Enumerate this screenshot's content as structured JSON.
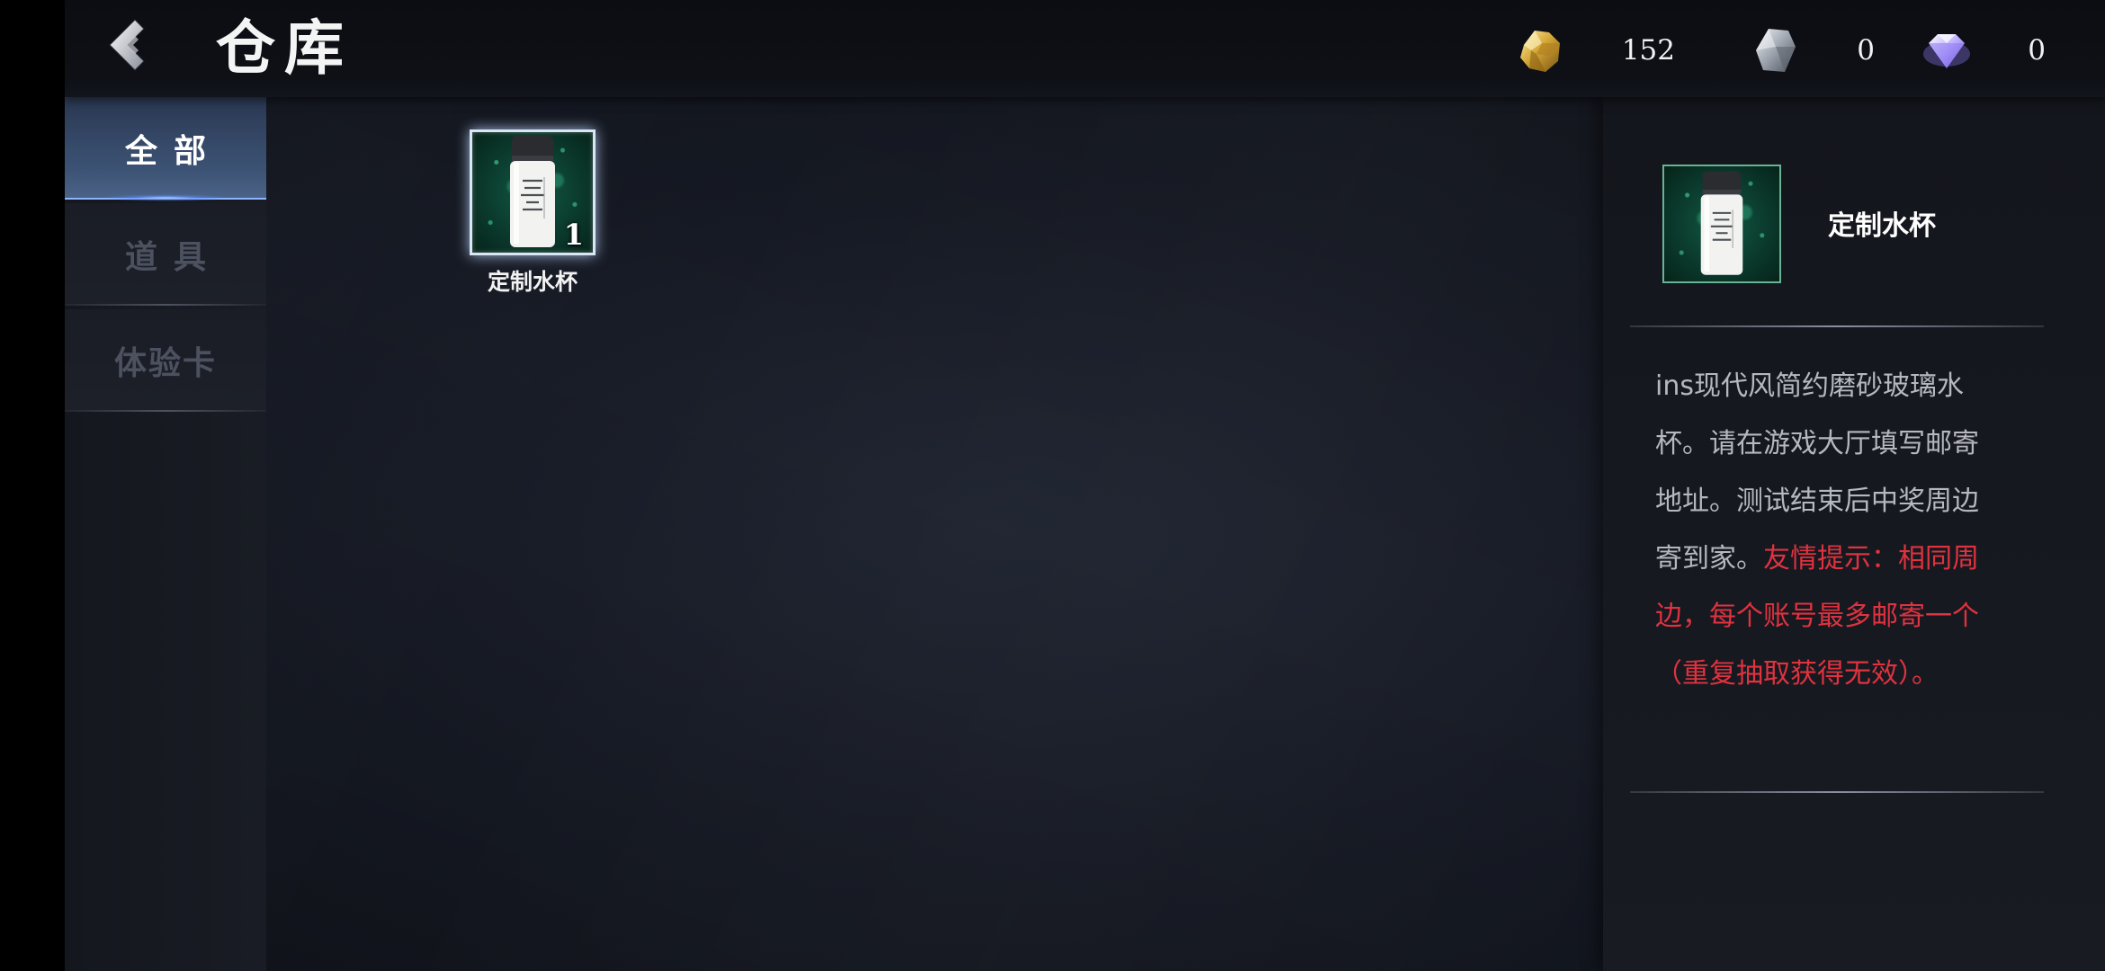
{
  "header": {
    "title": "仓库",
    "currencies": [
      {
        "icon": "gold-ore-icon",
        "value": "152"
      },
      {
        "icon": "silver-crystal-icon",
        "value": "0"
      },
      {
        "icon": "diamond-icon",
        "value": "0"
      }
    ]
  },
  "sidebar": {
    "items": [
      {
        "label": "全部",
        "active": true
      },
      {
        "label": "道具",
        "active": false
      },
      {
        "label": "体验卡",
        "active": false
      }
    ]
  },
  "inventory": {
    "items": [
      {
        "name": "定制水杯",
        "count": "1",
        "icon": "water-bottle-icon",
        "selected": true
      }
    ]
  },
  "detail": {
    "name": "定制水杯",
    "description": "ins现代风简约磨砂玻璃水杯。请在游戏大厅填写邮寄地址。测试结束后中奖周边寄到家。",
    "warning": "友情提示：相同周边，每个账号最多邮寄一个（重复抽取获得无效）。"
  },
  "colors": {
    "accent_blue": "#4b6488",
    "warning_red": "#e0323f",
    "item_bg_green": "#0b3b2e"
  }
}
